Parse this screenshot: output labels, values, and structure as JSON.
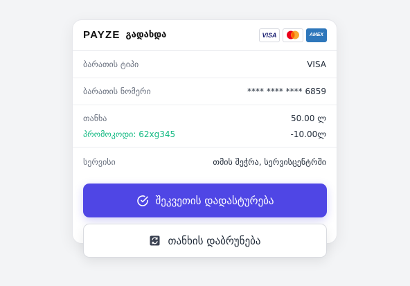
{
  "header": {
    "logo": "PAYZE",
    "title": "გადახდა",
    "card_brands": [
      {
        "name": "visa",
        "label": "VISA",
        "icon": "visa-logo"
      },
      {
        "name": "mastercard",
        "icon": "mastercard-logo"
      },
      {
        "name": "amex",
        "label": "AMEX",
        "icon": "amex-logo"
      }
    ]
  },
  "rows": {
    "card_type_label": "ბარათის ტიპი",
    "card_type_value": "VISA",
    "card_number_label": "ბარათის ნომერი",
    "card_number_value": "**** **** **** 6859",
    "amount_label": "თანხა",
    "amount_value": "50.00 ლ",
    "promo_label": "პრომოკოდი: 62xg345",
    "promo_value": "-10.00ლ",
    "service_label": "სერვისი",
    "service_value": "თმის შეჭრა, სერვისცენტრში"
  },
  "actions": {
    "confirm_label": "შეკვეთის დადასტურება",
    "refund_label": "თანხის დაბრუნება"
  },
  "colors": {
    "accent": "#4f46e5",
    "promo": "#10b981",
    "background": "#f3f4f6"
  }
}
